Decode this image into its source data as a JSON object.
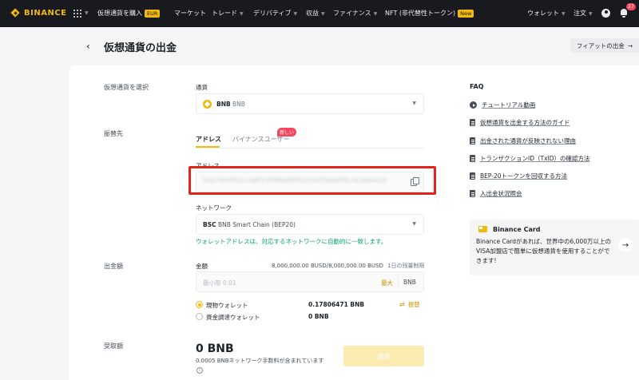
{
  "nav": {
    "logo": "BINANCE",
    "buy_crypto": "仮想通貨を購入",
    "buy_crypto_badge": "EUR",
    "markets": "マーケット",
    "trade": "トレード",
    "derivatives": "デリバティブ",
    "earn": "収益",
    "finance": "ファイナンス",
    "nft": "NFT (非代替性トークン)",
    "nft_badge": "New",
    "wallet": "ウォレット",
    "orders": "注文",
    "notification_count": "27"
  },
  "header": {
    "back": "‹",
    "title": "仮想通貨の出金",
    "fiat_button": "フィアットの出金",
    "fiat_arrow": "→"
  },
  "form": {
    "select_coin_label": "仮想通貨を選択",
    "coin_field_label": "通貨",
    "coin_symbol": "BNB",
    "coin_name": "BNB",
    "transfer_to_label": "振替先",
    "tab_address": "アドレス",
    "tab_binance_user": "バイナンスユーザー",
    "new_badge": "新しい",
    "address_label": "アドレス",
    "address_value": "bnb1f9030t1rcA8CF1f58bd00f4a1f3e2fb0d4f5c3e3b0ee32",
    "network_label": "ネットワーク",
    "network_code": "BSC",
    "network_name": "BNB Smart Chain (BEP20)",
    "network_notice": "ウォレットアドレスは、対応するネットワークに自動的に一致します。",
    "amount_section_label": "出金額",
    "amount_label": "金額",
    "limit_text": "8,000,000.00 BUSD/8,000,000.00 BUSD",
    "limit_suffix": "1日の残量制限",
    "amount_placeholder": "最小限 0.01",
    "max_label": "最大",
    "amount_unit": "BNB",
    "spot_wallet": "現物ウォレット",
    "spot_balance": "0.17806471 BNB",
    "funding_wallet": "資金調達ウォレット",
    "funding_balance": "0 BNB",
    "transfer_label": "振替",
    "receive_label": "受取額",
    "receive_amount": "0 BNB",
    "fee_note": "0.0005 BNBネットワーク手数料が含まれています",
    "info_mark": "i",
    "withdraw_button": "出金"
  },
  "faq": {
    "title": "FAQ",
    "items": [
      "チュートリアル動画",
      "仮想通貨を出金する方法のガイド",
      "出金された通貨が反映されない理由",
      "トランザクションID（TxID）の確認方法",
      "BEP-20トークンを回収する方法",
      "入出金状況照会"
    ]
  },
  "card": {
    "title": "Binance Card",
    "description": "Binance Cardがあれば、世界中の6,000万以上のVISA加盟店で簡単に仮想通貨を使用することができます!",
    "arrow": "→"
  },
  "colors": {
    "brand": "#f0b90b",
    "nav_bg": "#181a20",
    "success": "#03a66d",
    "highlight_border": "#e0251b"
  }
}
